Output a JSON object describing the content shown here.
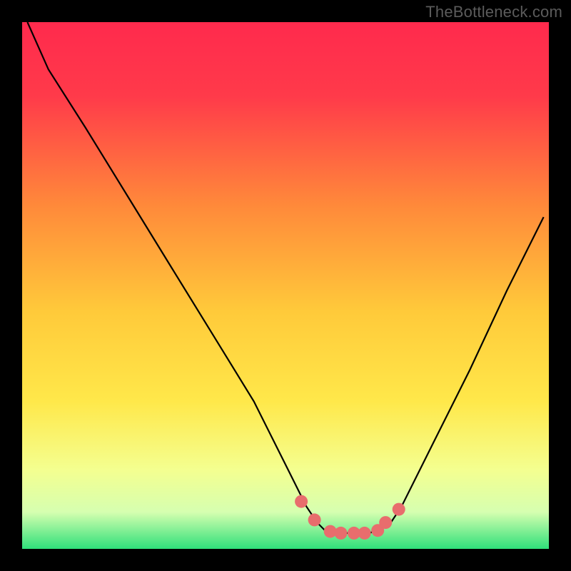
{
  "watermark": "TheBottleneck.com",
  "chart_data": {
    "type": "line",
    "title": "",
    "xlabel": "",
    "ylabel": "",
    "xlim": [
      0,
      100
    ],
    "ylim": [
      0,
      100
    ],
    "series": [
      {
        "name": "bottleneck-curve",
        "x": [
          1,
          5,
          12,
          20,
          28,
          36,
          44,
          50,
          54,
          56,
          58,
          60,
          63,
          66,
          70,
          72,
          78,
          85,
          92,
          99
        ],
        "values": [
          100,
          91,
          80,
          67,
          54,
          41,
          28,
          16,
          8,
          5,
          3,
          3,
          3,
          3,
          5,
          8,
          20,
          34,
          49,
          63
        ]
      }
    ],
    "marker_points": {
      "name": "highlight-region",
      "color": "#e86d6d",
      "x": [
        53,
        55.5,
        58.5,
        60.5,
        63,
        65,
        67.5,
        69,
        71.5
      ],
      "values": [
        9,
        5.5,
        3.3,
        3.0,
        3.0,
        3.0,
        3.5,
        5,
        7.5
      ]
    },
    "colors": {
      "frame": "#000000",
      "curve": "#000000",
      "gradient_top": "#ff2a4d",
      "gradient_mid": "#ffd63a",
      "gradient_low": "#f3ff9e",
      "gradient_bottom": "#2fe07a",
      "marker": "#e86d6d"
    }
  }
}
